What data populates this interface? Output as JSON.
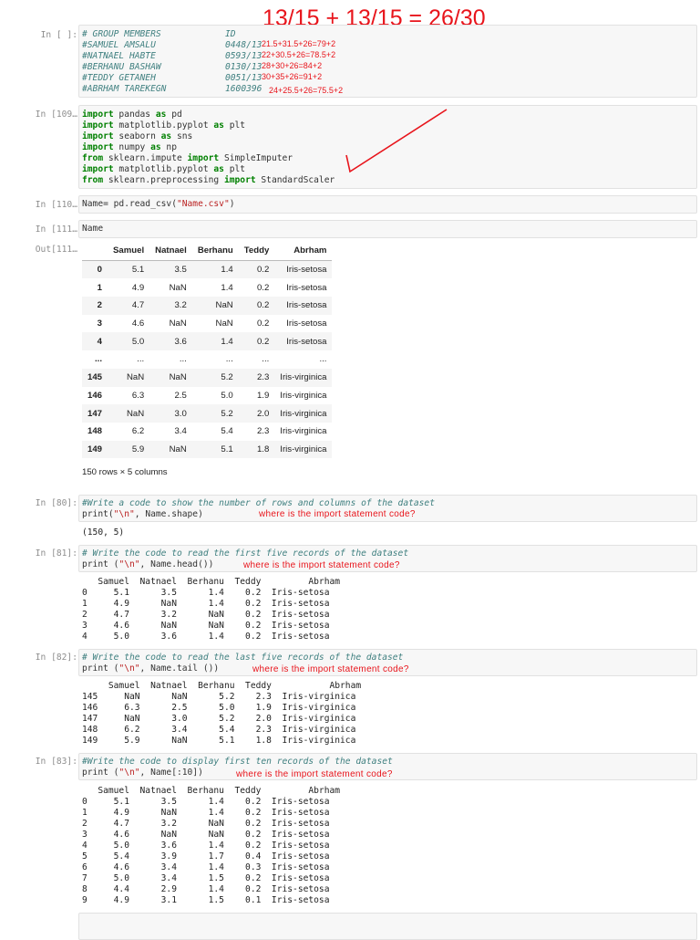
{
  "score": "13/15 + 13/15 = 26/30",
  "cells": {
    "c1": {
      "prompt": "In [ ]:",
      "lines": [
        [
          "# GROUP MEMBERS",
          "ID",
          ""
        ],
        [
          "#SAMUEL AMSALU",
          "0448/13",
          "21.5+31.5+26=79+2"
        ],
        [
          "#NATNAEL HABTE",
          "0593/13",
          "22+30.5+26=78.5+2"
        ],
        [
          "#BERHANU BASHAW",
          "0130/13",
          "28+30+26=84+2"
        ],
        [
          "#TEDDY GETANEH",
          "0051/13",
          "30+35+26=91+2"
        ],
        [
          "#ABRHAM TAREKEGN",
          "1600396",
          "24+25.5+26=75.5+2"
        ]
      ]
    },
    "c2": {
      "prompt": "In [109…",
      "imports": [
        {
          "a": "import",
          "b": " pandas ",
          "c": "as",
          "d": " pd"
        },
        {
          "a": "import",
          "b": " matplotlib.pyplot ",
          "c": "as",
          "d": " plt"
        },
        {
          "a": "import",
          "b": " seaborn ",
          "c": "as",
          "d": " sns"
        },
        {
          "a": "import",
          "b": " numpy ",
          "c": "as",
          "d": " np"
        },
        {
          "a": "from",
          "b": " sklearn.impute ",
          "c": "import",
          "d": " SimpleImputer"
        },
        {
          "a": "import",
          "b": " matplotlib.pyplot ",
          "c": "as",
          "d": " plt"
        },
        {
          "a": "from",
          "b": " sklearn.preprocessing ",
          "c": "import",
          "d": " StandardScaler"
        }
      ]
    },
    "c3": {
      "prompt": "In [110…",
      "code_a": "Name= pd.read_csv(",
      "code_b": "\"Name.csv\"",
      "code_c": ")"
    },
    "c4": {
      "prompt": "In [111…",
      "code": "Name",
      "out_prompt": "Out[111…",
      "columns": [
        "",
        "Samuel",
        "Natnael",
        "Berhanu",
        "Teddy",
        "Abrham"
      ],
      "rows": [
        [
          "0",
          "5.1",
          "3.5",
          "1.4",
          "0.2",
          "Iris-setosa"
        ],
        [
          "1",
          "4.9",
          "NaN",
          "1.4",
          "0.2",
          "Iris-setosa"
        ],
        [
          "2",
          "4.7",
          "3.2",
          "NaN",
          "0.2",
          "Iris-setosa"
        ],
        [
          "3",
          "4.6",
          "NaN",
          "NaN",
          "0.2",
          "Iris-setosa"
        ],
        [
          "4",
          "5.0",
          "3.6",
          "1.4",
          "0.2",
          "Iris-setosa"
        ],
        [
          "...",
          "...",
          "...",
          "...",
          "...",
          "..."
        ],
        [
          "145",
          "NaN",
          "NaN",
          "5.2",
          "2.3",
          "Iris-virginica"
        ],
        [
          "146",
          "6.3",
          "2.5",
          "5.0",
          "1.9",
          "Iris-virginica"
        ],
        [
          "147",
          "NaN",
          "3.0",
          "5.2",
          "2.0",
          "Iris-virginica"
        ],
        [
          "148",
          "6.2",
          "3.4",
          "5.4",
          "2.3",
          "Iris-virginica"
        ],
        [
          "149",
          "5.9",
          "NaN",
          "5.1",
          "1.8",
          "Iris-virginica"
        ]
      ],
      "shape_text": "150 rows × 5 columns"
    },
    "c5": {
      "prompt": "In [80]:",
      "comment": "#Write a code to show the number of rows and columns of the dataset",
      "code_a": "print(",
      "code_b": "\"\\n\"",
      "code_c": ", Name.shape)",
      "note": "where is the import statement code?",
      "output": "(150, 5)"
    },
    "c6": {
      "prompt": "In [81]:",
      "comment": "# Write the code to read the first five records of the dataset",
      "code_a": "print (",
      "code_b": "\"\\n\"",
      "code_c": ", Name.head())",
      "note": "where is the import statement code?",
      "output": "   Samuel  Natnael  Berhanu  Teddy         Abrham\n0     5.1      3.5      1.4    0.2  Iris-setosa\n1     4.9      NaN      1.4    0.2  Iris-setosa\n2     4.7      3.2      NaN    0.2  Iris-setosa\n3     4.6      NaN      NaN    0.2  Iris-setosa\n4     5.0      3.6      1.4    0.2  Iris-setosa"
    },
    "c7": {
      "prompt": "In [82]:",
      "comment": "# Write the code to read the last five records of the dataset",
      "code_a": "print (",
      "code_b": "\"\\n\"",
      "code_c": ", Name.tail ())",
      "note": "where is the import statement code?",
      "output": "     Samuel  Natnael  Berhanu  Teddy           Abrham\n145     NaN      NaN      5.2    2.3  Iris-virginica\n146     6.3      2.5      5.0    1.9  Iris-virginica\n147     NaN      3.0      5.2    2.0  Iris-virginica\n148     6.2      3.4      5.4    2.3  Iris-virginica\n149     5.9      NaN      5.1    1.8  Iris-virginica"
    },
    "c8": {
      "prompt": "In [83]:",
      "comment": "#Write the code to display first ten records of the dataset",
      "code_a": "print (",
      "code_b": "\"\\n\"",
      "code_c": ", Name[:10])",
      "note": "where is the import statement code?",
      "output": "   Samuel  Natnael  Berhanu  Teddy         Abrham\n0     5.1      3.5      1.4    0.2  Iris-setosa\n1     4.9      NaN      1.4    0.2  Iris-setosa\n2     4.7      3.2      NaN    0.2  Iris-setosa\n3     4.6      NaN      NaN    0.2  Iris-setosa\n4     5.0      3.6      1.4    0.2  Iris-setosa\n5     5.4      3.9      1.7    0.4  Iris-setosa\n6     4.6      3.4      1.4    0.3  Iris-setosa\n7     5.0      3.4      1.5    0.2  Iris-setosa\n8     4.4      2.9      1.4    0.2  Iris-setosa\n9     4.9      3.1      1.5    0.1  Iris-setosa"
    }
  }
}
